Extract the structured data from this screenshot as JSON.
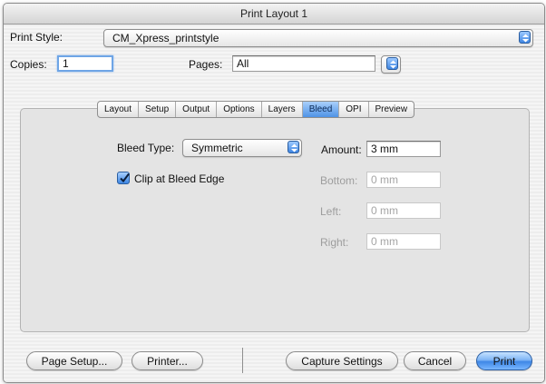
{
  "window": {
    "title": "Print Layout 1"
  },
  "print_style": {
    "label": "Print Style:",
    "value": "CM_Xpress_printstyle"
  },
  "copies": {
    "label": "Copies:",
    "value": "1"
  },
  "pages": {
    "label": "Pages:",
    "value": "All"
  },
  "tabs": [
    {
      "label": "Layout",
      "active": false
    },
    {
      "label": "Setup",
      "active": false
    },
    {
      "label": "Output",
      "active": false
    },
    {
      "label": "Options",
      "active": false
    },
    {
      "label": "Layers",
      "active": false
    },
    {
      "label": "Bleed",
      "active": true
    },
    {
      "label": "OPI",
      "active": false
    },
    {
      "label": "Preview",
      "active": false
    }
  ],
  "bleed": {
    "type_label": "Bleed Type:",
    "type_value": "Symmetric",
    "clip_label": "Clip at Bleed Edge",
    "clip_checked": true,
    "amount": {
      "label": "Amount:",
      "value": "3 mm",
      "enabled": true
    },
    "bottom": {
      "label": "Bottom:",
      "value": "0 mm",
      "enabled": false
    },
    "left": {
      "label": "Left:",
      "value": "0 mm",
      "enabled": false
    },
    "right": {
      "label": "Right:",
      "value": "0 mm",
      "enabled": false
    }
  },
  "buttons": {
    "page_setup": "Page Setup...",
    "printer": "Printer...",
    "capture_settings": "Capture Settings",
    "cancel": "Cancel",
    "print": "Print"
  },
  "colors": {
    "accent": "#4f93e6",
    "disabled_text": "#a5a5a5"
  },
  "icons": {
    "popup_arrows": "updown-arrows-icon",
    "checkmark": "checkmark-icon"
  }
}
